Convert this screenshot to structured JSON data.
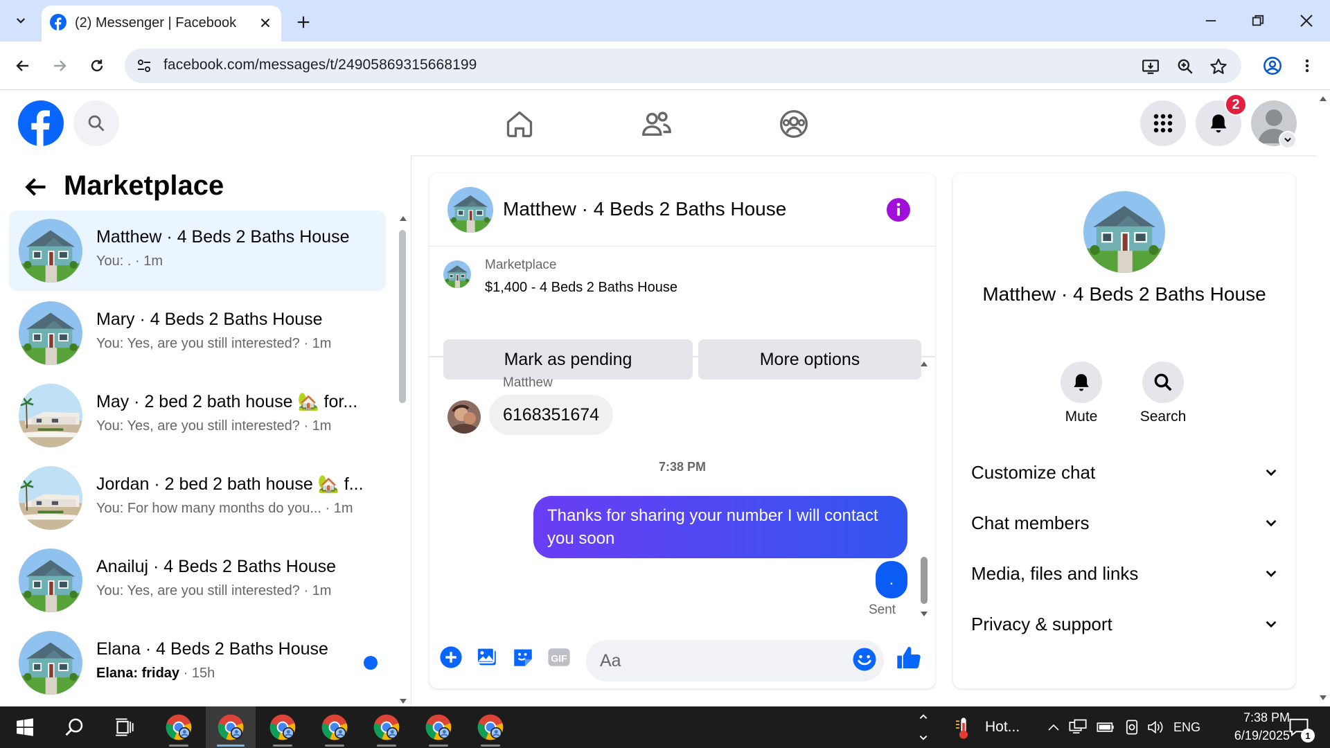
{
  "browser": {
    "tab_title": "(2) Messenger | Facebook",
    "url": "facebook.com/messages/t/24905869315668199"
  },
  "header": {
    "notification_count": "2"
  },
  "left": {
    "title": "Marketplace",
    "conversations": [
      {
        "name": "Matthew · 4 Beds 2 Baths House",
        "preview": "You: . · 1m",
        "active": true,
        "unread": false,
        "thumb": "house-teal"
      },
      {
        "name": "Mary · 4 Beds 2 Baths House",
        "preview": "You: Yes, are you still interested? · 1m",
        "active": false,
        "unread": false,
        "thumb": "house-teal"
      },
      {
        "name": "May · 2 bed 2 bath house 🏡 for...",
        "preview": "You: Yes, are you still interested? · 1m",
        "active": false,
        "unread": false,
        "thumb": "house-palm"
      },
      {
        "name": "Jordan · 2 bed 2 bath house 🏡 f...",
        "preview": "You: For how many months do you... · 1m",
        "active": false,
        "unread": false,
        "thumb": "house-palm"
      },
      {
        "name": "Anailuj · 4 Beds 2 Baths House",
        "preview": "You: Yes, are you still interested? · 1m",
        "active": false,
        "unread": false,
        "thumb": "house-teal"
      },
      {
        "name": "Elana · 4 Beds 2 Baths House",
        "preview_sender": "Elana: friday",
        "preview": " · 15h",
        "active": false,
        "unread": true,
        "thumb": "house-teal"
      }
    ]
  },
  "chat": {
    "title": "Matthew · 4 Beds 2 Baths House",
    "listing_source": "Marketplace",
    "listing_price_title": "$1,400 - 4 Beds 2 Baths House",
    "mark_pending_label": "Mark as pending",
    "more_options_label": "More options",
    "sender_name": "Matthew",
    "incoming_message": "6168351674",
    "timestamp": "7:38 PM",
    "outgoing_message": "Thanks for sharing your number I will contact you soon",
    "outgoing_message_2": ".",
    "sent_label": "Sent",
    "input_placeholder": "Aa"
  },
  "info": {
    "title": "Matthew · 4 Beds 2 Baths House",
    "mute_label": "Mute",
    "search_label": "Search",
    "sections": [
      "Customize chat",
      "Chat members",
      "Media, files and links",
      "Privacy & support"
    ]
  },
  "taskbar": {
    "weather_label": "Hot...",
    "lang": "ENG",
    "time": "7:38 PM",
    "date": "6/19/2025",
    "notification_count": "1"
  },
  "colors": {
    "fb_blue": "#0866ff",
    "outgoing_bubble_start": "#6a3df5",
    "outgoing_bubble_end": "#3155f0",
    "info_purple": "#a10eda"
  }
}
